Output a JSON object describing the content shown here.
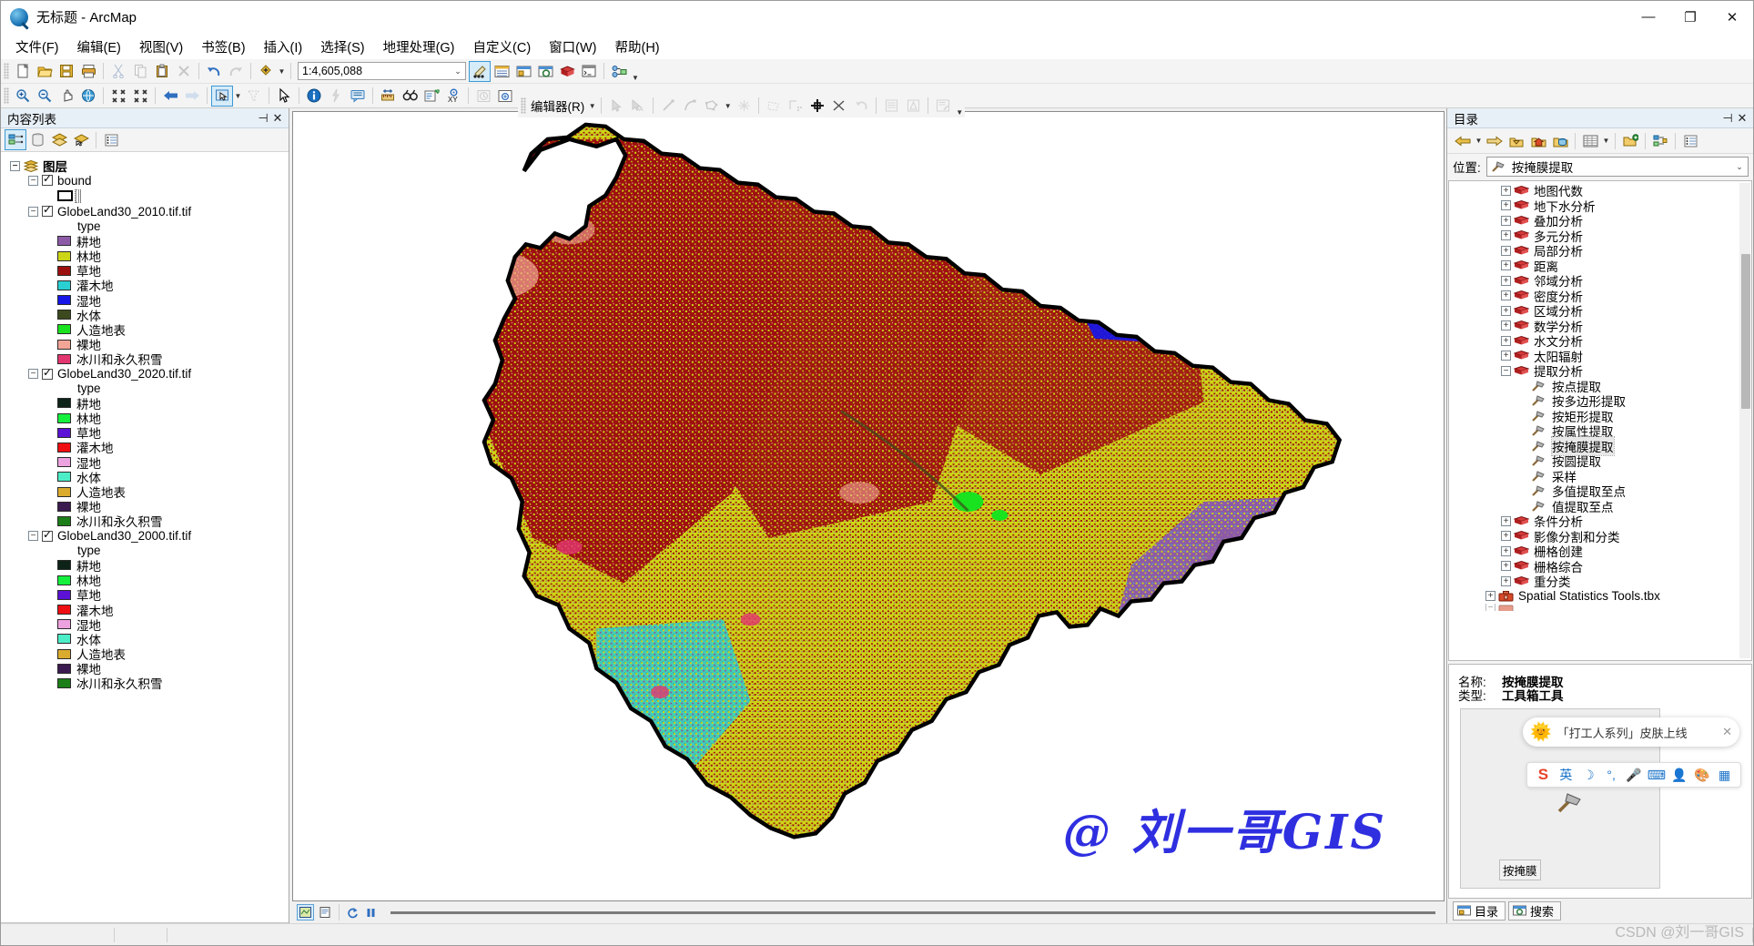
{
  "window": {
    "title": "无标题 - ArcMap",
    "app_icon": "arcmap-globe-icon",
    "minimize": "—",
    "maximize": "❐",
    "close": "✕"
  },
  "menubar": [
    {
      "label": "文件(F)",
      "name": "menu-file"
    },
    {
      "label": "编辑(E)",
      "name": "menu-edit"
    },
    {
      "label": "视图(V)",
      "name": "menu-view"
    },
    {
      "label": "书签(B)",
      "name": "menu-bookmarks"
    },
    {
      "label": "插入(I)",
      "name": "menu-insert"
    },
    {
      "label": "选择(S)",
      "name": "menu-selection"
    },
    {
      "label": "地理处理(G)",
      "name": "menu-geoprocessing"
    },
    {
      "label": "自定义(C)",
      "name": "menu-customize"
    },
    {
      "label": "窗口(W)",
      "name": "menu-window"
    },
    {
      "label": "帮助(H)",
      "name": "menu-help"
    }
  ],
  "standard_toolbar": {
    "scale_value": "1:4,605,088",
    "buttons": [
      "new-document-icon",
      "open-icon",
      "save-icon",
      "print-icon",
      "cut-icon",
      "copy-icon",
      "paste-icon",
      "delete-icon",
      "undo-icon",
      "redo-icon",
      "add-data-icon",
      "editor-toolbar-icon",
      "table-of-contents-icon",
      "catalog-icon",
      "search-icon",
      "arctoolbox-icon",
      "python-window-icon",
      "modelbuilder-icon"
    ]
  },
  "tools_toolbar": {
    "buttons": [
      "zoom-in-icon",
      "zoom-out-icon",
      "pan-icon",
      "full-extent-icon",
      "fixed-zoom-in-icon",
      "fixed-zoom-out-icon",
      "go-back-extent-icon",
      "go-next-extent-icon",
      "select-features-icon",
      "clear-selection-icon",
      "select-elements-icon",
      "identify-icon",
      "hyperlink-icon",
      "html-popup-icon",
      "measure-icon",
      "find-icon",
      "find-route-icon",
      "go-to-xy-icon",
      "time-slider-icon",
      "create-viewer-window-icon"
    ]
  },
  "editor_toolbar": {
    "label": "编辑器(R)",
    "buttons": [
      "edit-tool-icon",
      "edit-annotation-icon",
      "straight-segment-icon",
      "curve-segment-icon",
      "construction-tools-icon",
      "sketch-properties-icon",
      "split-polygon-icon",
      "rotate-icon",
      "merge-icon",
      "cut-icon",
      "undo-edit-icon",
      "attributes-icon",
      "sketch-properties-table-icon",
      "create-features-icon"
    ]
  },
  "toc": {
    "title": "内容列表",
    "pin_icon": "pin-icon",
    "close_icon": "close-icon",
    "toolbar_buttons": [
      "list-by-drawing-order-icon",
      "list-by-source-icon",
      "list-by-visibility-icon",
      "list-by-selection-icon",
      "options-icon"
    ],
    "root": "图层",
    "layers": [
      {
        "name": "bound",
        "checked": true,
        "kind": "vector",
        "symbol": "hollow-polygon-outline"
      },
      {
        "name": "GlobeLand30_2010.tif.tif",
        "checked": true,
        "field": "type",
        "classes": [
          {
            "label": "耕地",
            "color": "#8d5aa8"
          },
          {
            "label": "林地",
            "color": "#cdd616"
          },
          {
            "label": "草地",
            "color": "#9d1010"
          },
          {
            "label": "灌木地",
            "color": "#29cfd1"
          },
          {
            "label": "湿地",
            "color": "#1616e8"
          },
          {
            "label": "水体",
            "color": "#3c4a1d"
          },
          {
            "label": "人造地表",
            "color": "#19e21f"
          },
          {
            "label": "裸地",
            "color": "#f2a596"
          },
          {
            "label": "冰川和永久积雪",
            "color": "#e23670"
          }
        ]
      },
      {
        "name": "GlobeLand30_2020.tif.tif",
        "checked": true,
        "field": "type",
        "classes": [
          {
            "label": "耕地",
            "color": "#0d2317"
          },
          {
            "label": "林地",
            "color": "#14f03c"
          },
          {
            "label": "草地",
            "color": "#5b12d6"
          },
          {
            "label": "灌木地",
            "color": "#ef0e12"
          },
          {
            "label": "湿地",
            "color": "#eda2e0"
          },
          {
            "label": "水体",
            "color": "#4ceec7"
          },
          {
            "label": "人造地表",
            "color": "#dbab2e"
          },
          {
            "label": "裸地",
            "color": "#3b1a50"
          },
          {
            "label": "冰川和永久积雪",
            "color": "#1b7e18"
          }
        ]
      },
      {
        "name": "GlobeLand30_2000.tif.tif",
        "checked": true,
        "field": "type",
        "classes": [
          {
            "label": "耕地",
            "color": "#0d2317"
          },
          {
            "label": "林地",
            "color": "#14f03c"
          },
          {
            "label": "草地",
            "color": "#5b12d6"
          },
          {
            "label": "灌木地",
            "color": "#ef0e12"
          },
          {
            "label": "湿地",
            "color": "#eda2e0"
          },
          {
            "label": "水体",
            "color": "#4ceec7"
          },
          {
            "label": "人造地表",
            "color": "#dbab2e"
          },
          {
            "label": "裸地",
            "color": "#3b1a50"
          },
          {
            "label": "冰川和永久积雪",
            "color": "#1b7e18"
          }
        ]
      }
    ]
  },
  "map": {
    "watermark": "@ 刘一哥GIS",
    "status_buttons": [
      "data-view-icon",
      "layout-view-icon",
      "refresh-icon",
      "pause-drawing-icon"
    ],
    "landcover_colors": {
      "cropland": "#8d5aa8",
      "forest": "#cdd616",
      "grassland": "#9d1010",
      "shrubland": "#29cfd1",
      "wetland": "#1616e8",
      "water": "#3c4a1d",
      "artificial": "#19e21f",
      "bareland": "#f2a596",
      "snow_ice": "#e23670"
    }
  },
  "catalog": {
    "title": "目录",
    "pin_icon": "pin-icon",
    "close_icon": "close-icon",
    "toolbar_buttons": [
      "back-icon",
      "forward-icon",
      "up-one-level-icon",
      "home-icon",
      "default-geodatabase-icon",
      "toggle-contents-panel-icon",
      "connect-folder-icon",
      "toolboxes-icon",
      "description-icon"
    ],
    "location_label": "位置:",
    "location_value": "按掩膜提取",
    "location_icon": "hammer-icon",
    "tree": [
      {
        "label": "地图代数",
        "indent": 2,
        "type": "toolset",
        "expanded": false
      },
      {
        "label": "地下水分析",
        "indent": 2,
        "type": "toolset",
        "expanded": false
      },
      {
        "label": "叠加分析",
        "indent": 2,
        "type": "toolset",
        "expanded": false
      },
      {
        "label": "多元分析",
        "indent": 2,
        "type": "toolset",
        "expanded": false
      },
      {
        "label": "局部分析",
        "indent": 2,
        "type": "toolset",
        "expanded": false
      },
      {
        "label": "距离",
        "indent": 2,
        "type": "toolset",
        "expanded": false
      },
      {
        "label": "邻域分析",
        "indent": 2,
        "type": "toolset",
        "expanded": false
      },
      {
        "label": "密度分析",
        "indent": 2,
        "type": "toolset",
        "expanded": false
      },
      {
        "label": "区域分析",
        "indent": 2,
        "type": "toolset",
        "expanded": false
      },
      {
        "label": "数学分析",
        "indent": 2,
        "type": "toolset",
        "expanded": false
      },
      {
        "label": "水文分析",
        "indent": 2,
        "type": "toolset",
        "expanded": false
      },
      {
        "label": "太阳辐射",
        "indent": 2,
        "type": "toolset",
        "expanded": false
      },
      {
        "label": "提取分析",
        "indent": 2,
        "type": "toolset",
        "expanded": true
      },
      {
        "label": "按点提取",
        "indent": 3,
        "type": "tool"
      },
      {
        "label": "按多边形提取",
        "indent": 3,
        "type": "tool"
      },
      {
        "label": "按矩形提取",
        "indent": 3,
        "type": "tool"
      },
      {
        "label": "按属性提取",
        "indent": 3,
        "type": "tool"
      },
      {
        "label": "按掩膜提取",
        "indent": 3,
        "type": "tool",
        "selected": true
      },
      {
        "label": "按圆提取",
        "indent": 3,
        "type": "tool"
      },
      {
        "label": "采样",
        "indent": 3,
        "type": "tool"
      },
      {
        "label": "多值提取至点",
        "indent": 3,
        "type": "tool"
      },
      {
        "label": "值提取至点",
        "indent": 3,
        "type": "tool"
      },
      {
        "label": "条件分析",
        "indent": 2,
        "type": "toolset",
        "expanded": false
      },
      {
        "label": "影像分割和分类",
        "indent": 2,
        "type": "toolset",
        "expanded": false
      },
      {
        "label": "栅格创建",
        "indent": 2,
        "type": "toolset",
        "expanded": false
      },
      {
        "label": "栅格综合",
        "indent": 2,
        "type": "toolset",
        "expanded": false
      },
      {
        "label": "重分类",
        "indent": 2,
        "type": "toolset",
        "expanded": false
      },
      {
        "label": "Spatial Statistics Tools.tbx",
        "indent": 1,
        "type": "toolbox",
        "expanded": false
      }
    ],
    "description": {
      "name_label": "名称:",
      "name_value": "按掩膜提取",
      "type_label": "类型:",
      "type_value": "工具箱工具",
      "thumb_icon": "hammer-icon",
      "tooltip": "按掩膜"
    },
    "tabs": [
      {
        "label": "目录",
        "icon": "catalog-icon",
        "active": true
      },
      {
        "label": "搜索",
        "icon": "search-icon",
        "active": false
      }
    ]
  },
  "ime": {
    "popup_message": "「打工人系列」皮肤上线",
    "popup_icon": "sun-icon",
    "close_icon": "✕",
    "bar_icons": [
      "sogou-logo-icon",
      "english-mode-icon",
      "moon-icon",
      "punctuation-icon",
      "microphone-icon",
      "soft-keyboard-icon",
      "user-icon",
      "skin-icon",
      "apps-icon"
    ],
    "bar_labels": [
      "S",
      "英",
      "☽",
      "°,",
      "🎤",
      "⌨",
      "👤",
      "🎨",
      "▦"
    ]
  },
  "footer": {
    "csdn": "CSDN @刘一哥GIS"
  }
}
